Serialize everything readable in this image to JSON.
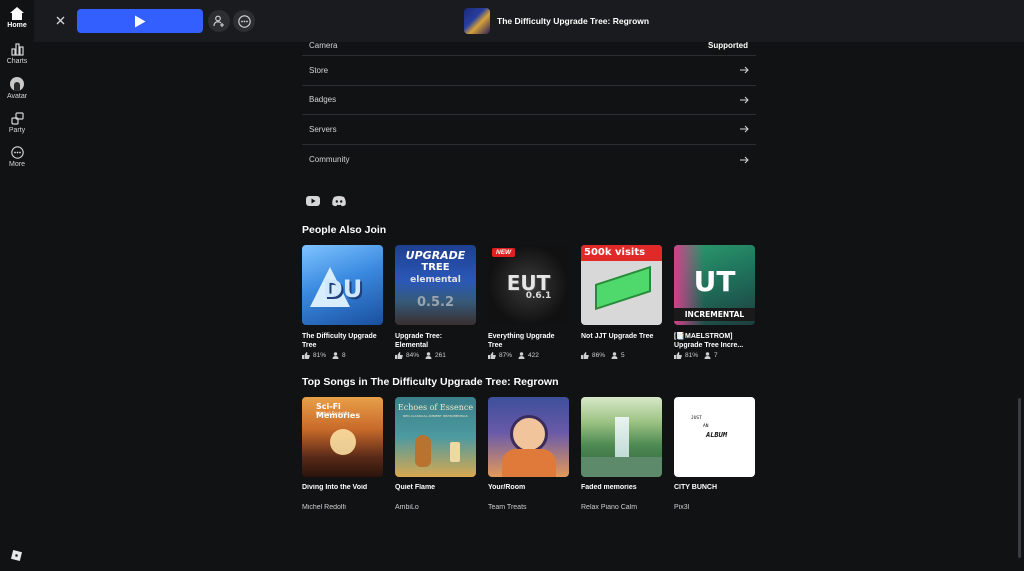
{
  "nav": {
    "items": [
      {
        "label": "Home",
        "icon": "home-icon"
      },
      {
        "label": "Charts",
        "icon": "charts-icon"
      },
      {
        "label": "Avatar",
        "icon": "avatar-icon"
      },
      {
        "label": "Party",
        "icon": "party-icon"
      },
      {
        "label": "More",
        "icon": "more-icon"
      }
    ]
  },
  "topbar": {
    "game_title": "The Difficulty Upgrade Tree: Regrown",
    "play_color": "#335fff"
  },
  "details": {
    "camera_label": "Camera",
    "camera_value": "Supported",
    "links": [
      "Store",
      "Badges",
      "Servers",
      "Community"
    ]
  },
  "people_also_join": {
    "title": "People Also Join",
    "games": [
      {
        "name": "The Difficulty Upgrade Tree",
        "rating": "81%",
        "players": "8"
      },
      {
        "name": "Upgrade Tree: Elemental",
        "rating": "84%",
        "players": "261"
      },
      {
        "name": "Everything Upgrade Tree",
        "rating": "87%",
        "players": "422",
        "badge": "NEW",
        "thumb_text": "EUT",
        "thumb_sub": "0.6.1"
      },
      {
        "name": "Not JJT Upgrade Tree",
        "rating": "86%",
        "players": "5",
        "thumb_text": "500k visits"
      },
      {
        "name": "[📑MAELSTROM] Upgrade Tree Incre...",
        "rating": "81%",
        "players": "7",
        "thumb_text": "UT",
        "thumb_sub": "INCREMENTAL"
      }
    ],
    "thumb_misc": {
      "g1": "DU",
      "g2_line1": "UPGRADE",
      "g2_line2": "TREE",
      "g2_line3": "elemental",
      "g2_line4": "0.5.2"
    }
  },
  "top_songs": {
    "title": "Top Songs in The Difficulty Upgrade Tree: Regrown",
    "songs": [
      {
        "title": "Diving Into the Void",
        "artist": "Michel Redolfi",
        "cover_text": "Sci-Fi Memories",
        "cover_sub": "Michel Redolfi"
      },
      {
        "title": "Quiet Flame",
        "artist": "AmbiLo",
        "cover_text": "Echoes of Essence",
        "cover_sub": "NEO-CLASSICAL AMBIENT INSTRUMENTALS"
      },
      {
        "title": "Your/Room",
        "artist": "Team Treats"
      },
      {
        "title": "Faded memories",
        "artist": "Relax Piano Calm"
      },
      {
        "title": "CITY BUNCH",
        "artist": "Pix3l",
        "cover_text_1": "JUST",
        "cover_text_2": "AN",
        "cover_text_3": "ALBUM"
      }
    ]
  }
}
